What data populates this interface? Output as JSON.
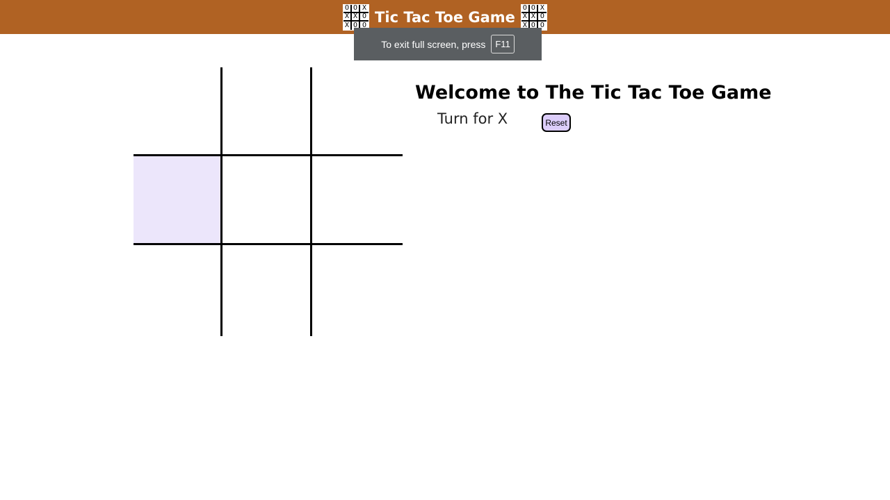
{
  "header": {
    "title": "Tic Tac Toe Game",
    "logo_icon": "tic-tac-toe-icon",
    "logo_cells": [
      "O",
      "O",
      "X",
      "X",
      "X",
      "O",
      "X",
      "O",
      "O"
    ],
    "background_color": "#b06223"
  },
  "fullscreen_notice": {
    "text": "To exit full screen, press",
    "key": "F11"
  },
  "main": {
    "heading": "Welcome to The Tic Tac Toe Game",
    "turn_text": "Turn for X",
    "reset_label": "Reset",
    "reset_color": "#dccdfa"
  },
  "board": {
    "cells": [
      "",
      "",
      "",
      "",
      "",
      "",
      "",
      "",
      ""
    ],
    "hovered_cell_index": 3,
    "hover_color": "#ece6fb"
  }
}
